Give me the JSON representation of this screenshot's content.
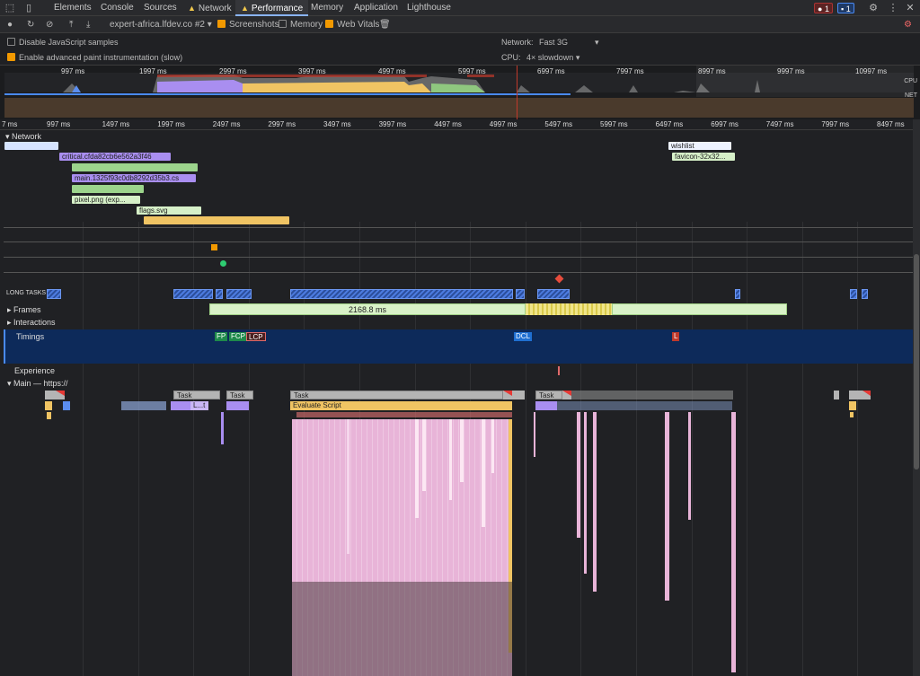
{
  "tabs": [
    {
      "label": "Elements",
      "active": false,
      "warn": false
    },
    {
      "label": "Console",
      "active": false,
      "warn": false
    },
    {
      "label": "Sources",
      "active": false,
      "warn": false
    },
    {
      "label": "Network",
      "active": false,
      "warn": true
    },
    {
      "label": "Performance",
      "active": true,
      "warn": true
    },
    {
      "label": "Memory",
      "active": false,
      "warn": false
    },
    {
      "label": "Application",
      "active": false,
      "warn": false
    },
    {
      "label": "Lighthouse",
      "active": false,
      "warn": false
    }
  ],
  "badges": {
    "errors": "1",
    "messages": "1"
  },
  "toolbar": {
    "profile": "expert-africa.lfdev.co #2",
    "screenshots": "Screenshots",
    "memory": "Memory",
    "web_vitals": "Web Vitals"
  },
  "settings": {
    "disable_js": "Disable JavaScript samples",
    "paint": "Enable advanced paint instrumentation (slow)",
    "network_label": "Network:",
    "network_value": "Fast 3G",
    "cpu_label": "CPU:",
    "cpu_value": "4× slowdown"
  },
  "overview_ticks": [
    "997 ms",
    "1997 ms",
    "2997 ms",
    "3997 ms",
    "4997 ms",
    "5997 ms",
    "6997 ms",
    "7997 ms",
    "8997 ms",
    "9997 ms",
    "10997 ms"
  ],
  "overview_labels": {
    "cpu": "CPU",
    "net": "NET"
  },
  "ruler_ticks": [
    "7 ms",
    "997 ms",
    "1497 ms",
    "1997 ms",
    "2497 ms",
    "2997 ms",
    "3497 ms",
    "3997 ms",
    "4497 ms",
    "4997 ms",
    "5497 ms",
    "5997 ms",
    "6497 ms",
    "6997 ms",
    "7497 ms",
    "7997 ms",
    "8497 ms"
  ],
  "tracks": {
    "network": "Network",
    "long_tasks": "LONG TASKS",
    "frames": "Frames",
    "frame_duration": "2168.8 ms",
    "interactions": "Interactions",
    "timings": "Timings",
    "experience": "Experience",
    "main": "Main — https://"
  },
  "network_requests": [
    {
      "label": "critical.cfda82cb6e562a3f46",
      "color": "#a98ef0"
    },
    {
      "label": "main.1325f93c0db8292d35b3.cs",
      "color": "#a98ef0"
    },
    {
      "label": "pixel.png (exp...",
      "color": "#9cd48c"
    },
    {
      "label": "flags.svg",
      "color": "#9cd48c"
    },
    {
      "label": "wishlist",
      "color": "#d6e4ff"
    },
    {
      "label": "favicon-32x32...",
      "color": "#9cd48c"
    }
  ],
  "timings": [
    {
      "label": "FP",
      "color": "#1e8a4b"
    },
    {
      "label": "FCP",
      "color": "#1e8a4b"
    },
    {
      "label": "LCP",
      "color": "#4a1f1f"
    },
    {
      "label": "DCL",
      "color": "#1f6fd1"
    },
    {
      "label": "L",
      "color": "#c0392b"
    }
  ],
  "main_events": {
    "task": "Task",
    "evaluate": "Evaluate Script",
    "short": "L...t"
  }
}
